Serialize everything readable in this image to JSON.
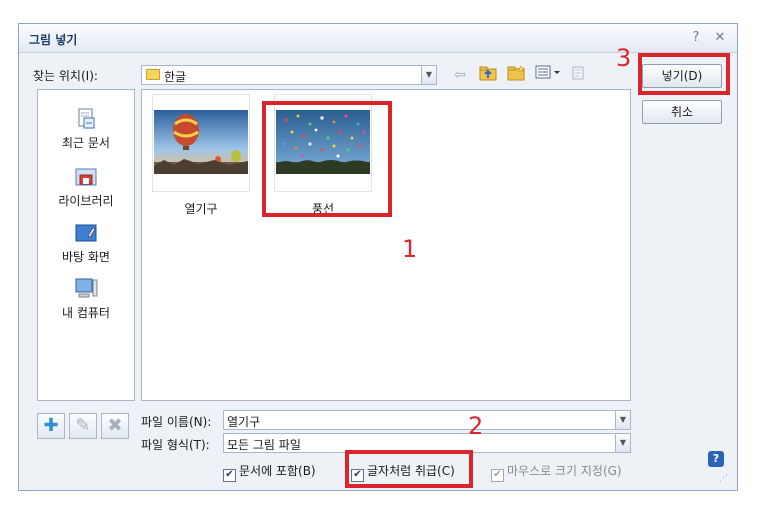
{
  "window": {
    "title": "그림 넣기",
    "help_glyph": "?",
    "close_glyph": "✕"
  },
  "lookin": {
    "label": "찾는 위치(I):",
    "value": "한글"
  },
  "places": [
    {
      "label": "최근 문서"
    },
    {
      "label": "라이브러리"
    },
    {
      "label": "바탕 화면"
    },
    {
      "label": "내 컴퓨터"
    }
  ],
  "files": [
    {
      "name": "열기구"
    },
    {
      "name": "풍선"
    }
  ],
  "buttons": {
    "insert": "넣기(D)",
    "cancel": "취소"
  },
  "filename": {
    "label": "파일 이름(N):",
    "value": "열기구"
  },
  "filetype": {
    "label": "파일 형식(T):",
    "value": "모든 그림 파일"
  },
  "options": [
    {
      "label": "문서에 포함(B)",
      "checked": true,
      "enabled": true
    },
    {
      "label": "글자처럼 취급(C)",
      "checked": true,
      "enabled": true
    },
    {
      "label": "마우스로 크기 지정(G)",
      "checked": true,
      "enabled": false
    }
  ],
  "annotations": {
    "label_1": "1",
    "label_2": "2",
    "label_3": "3"
  },
  "colors": {
    "annotation_red": "#d9252b",
    "title_blue": "#1d3a6b"
  }
}
